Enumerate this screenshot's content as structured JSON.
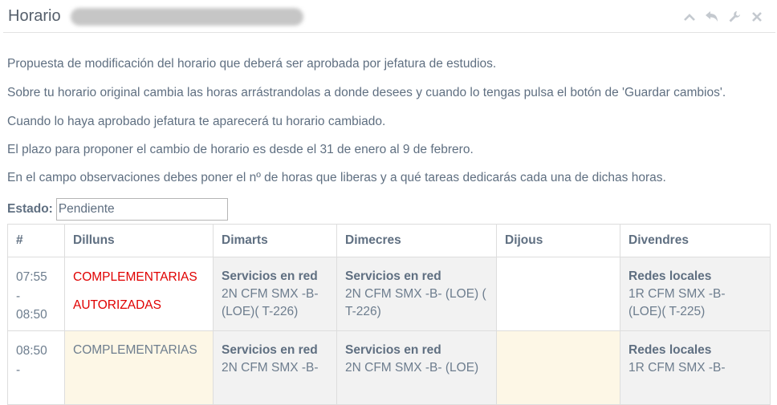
{
  "header": {
    "title": "Horario",
    "tools": [
      "chevron-up-icon",
      "undo-icon",
      "wrench-icon",
      "close-icon"
    ]
  },
  "intro": [
    "Propuesta de modificación del horario que deberá ser aprobada por jefatura de estudios.",
    "Sobre tu horario original cambia las horas arrástrandolas a donde desees y cuando lo tengas pulsa el botón de 'Guardar cambios'.",
    "Cuando lo haya aprobado jefatura te aparecerá tu horario cambiado.",
    "El plazo para proponer el cambio de horario es desde el 31 de enero al 9 de febrero.",
    "En el campo observaciones debes poner el nº de horas que liberas y a qué tareas dedicarás cada una de dichas horas."
  ],
  "estado": {
    "label": "Estado:",
    "value": "Pendiente"
  },
  "table": {
    "headers": [
      "#",
      "Dilluns",
      "Dimarts",
      "Dimecres",
      "Dijous",
      "Divendres"
    ],
    "rows": [
      {
        "time": "07:55\n-\n08:50",
        "dilluns": {
          "text": "COMPLEMENTARIAS\nAUTORIZADAS"
        },
        "dimarts": {
          "subject": "Servicios en red",
          "detail": "2N CFM SMX -B- (LOE)( T-226)"
        },
        "dimecres": {
          "subject": "Servicios en red",
          "detail": "2N CFM SMX -B- (LOE) ( T-226)"
        },
        "dijous": {
          "subject": "",
          "detail": ""
        },
        "divendres": {
          "subject": "Redes locales",
          "detail": "1R CFM SMX -B- (LOE)( T-225)"
        }
      },
      {
        "time": "08:50\n-",
        "dilluns": {
          "text": "COMPLEMENTARIAS"
        },
        "dimarts": {
          "subject": "Servicios en red",
          "detail": "2N CFM SMX -B-"
        },
        "dimecres": {
          "subject": "Servicios en red",
          "detail": "2N CFM SMX -B- (LOE)"
        },
        "dijous": {
          "subject": "",
          "detail": ""
        },
        "divendres": {
          "subject": "Redes locales",
          "detail": "1R CFM SMX -B-"
        }
      }
    ]
  },
  "colors": {
    "text": "#5f6f81",
    "alert": "#e00000",
    "grey_cell": "#f2f2f2",
    "cream_cell": "#fdf7e6",
    "border": "#dddddd"
  }
}
